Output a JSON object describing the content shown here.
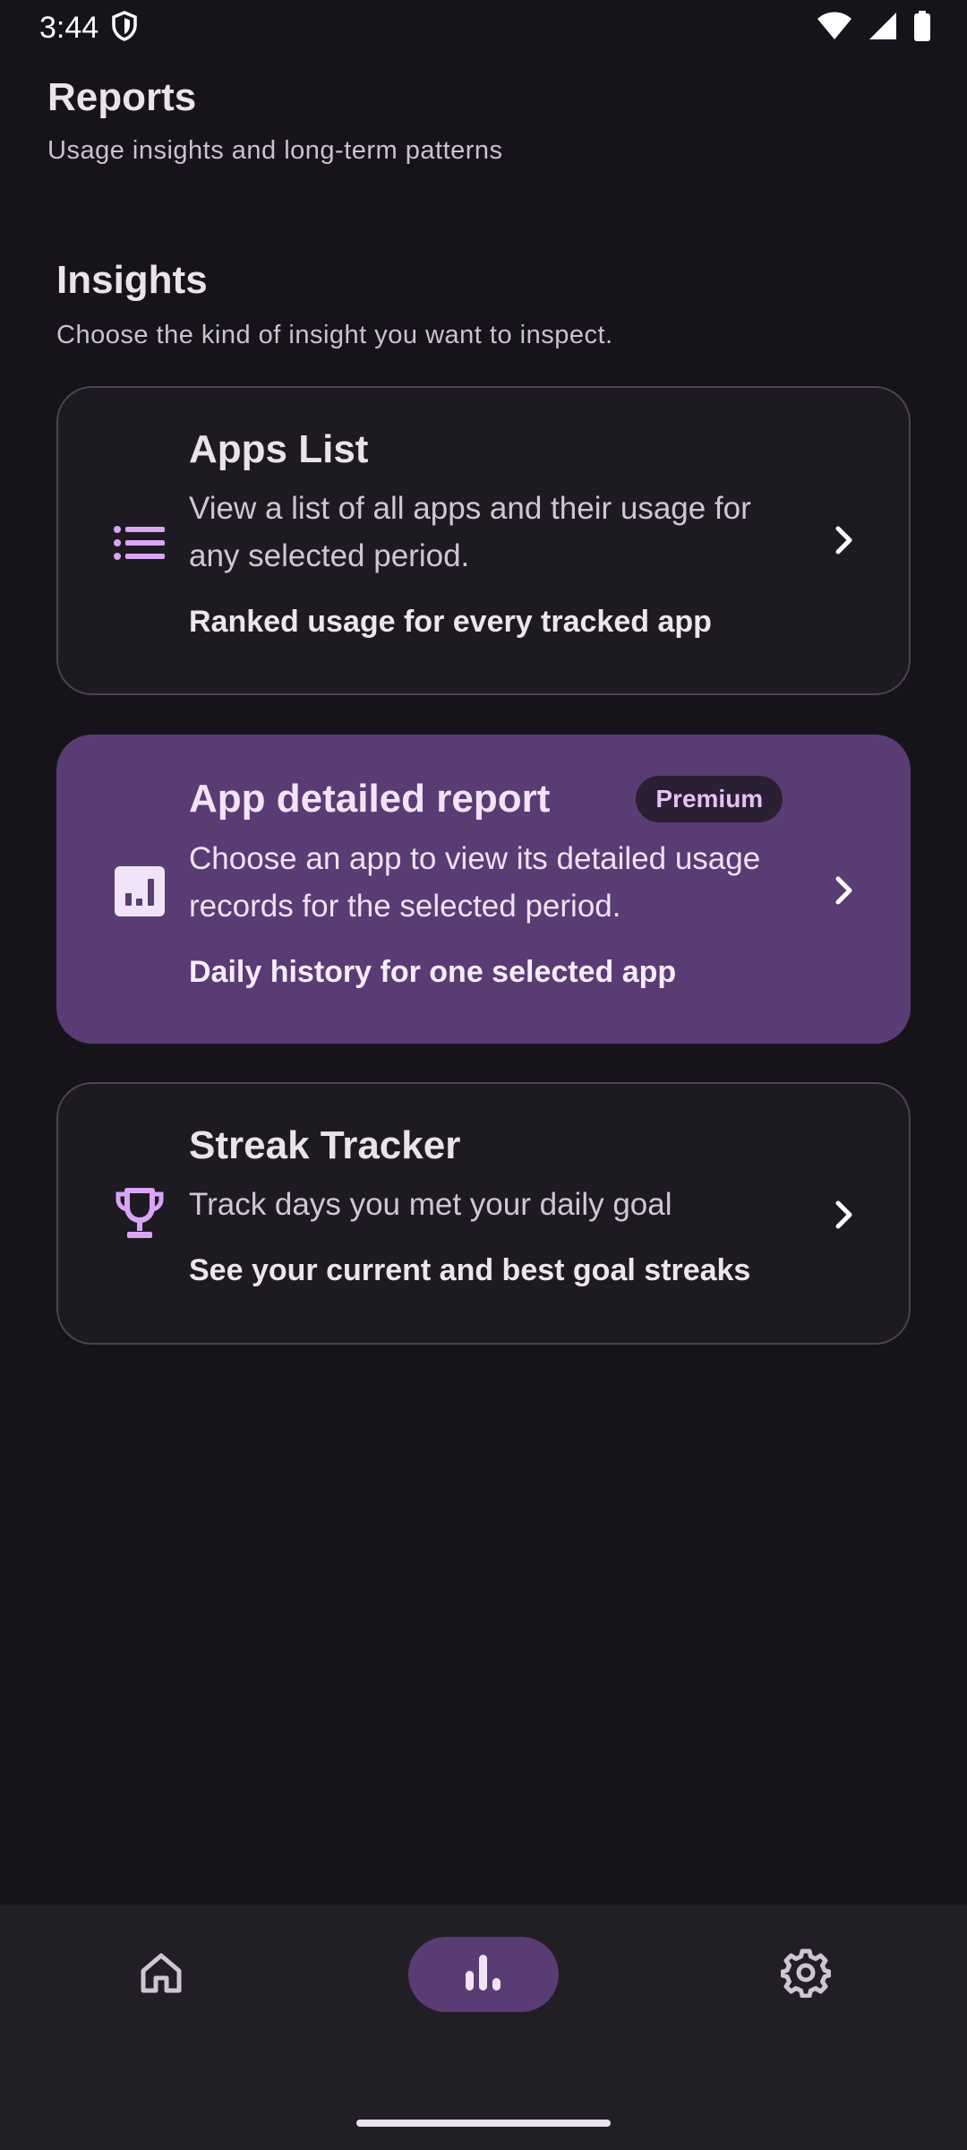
{
  "status_bar": {
    "time": "3:44",
    "icons": [
      "shield-icon",
      "wifi-icon",
      "signal-icon",
      "battery-icon"
    ]
  },
  "header": {
    "title": "Reports",
    "subtitle": "Usage insights and long-term patterns"
  },
  "insights": {
    "title": "Insights",
    "subtitle": "Choose the kind of insight you want to inspect.",
    "cards": [
      {
        "icon": "list-icon",
        "title": "Apps List",
        "description": "View a list of all apps and their usage for any selected period.",
        "note": "Ranked usage for every tracked app"
      },
      {
        "icon": "bar-chart-icon",
        "title": "App detailed report",
        "badge": "Premium",
        "description": "Choose an app to view its detailed usage records for the selected period.",
        "note": "Daily history for one selected app"
      },
      {
        "icon": "trophy-icon",
        "title": "Streak Tracker",
        "description": "Track days you met your daily goal",
        "note": "See your current and best goal streaks"
      }
    ]
  },
  "bottom_nav": {
    "items": [
      {
        "icon": "home-icon",
        "active": false
      },
      {
        "icon": "reports-icon",
        "active": true
      },
      {
        "icon": "settings-icon",
        "active": false
      }
    ]
  },
  "colors": {
    "background": "#16141a",
    "accent": "#5a3c74",
    "icon_tint": "#d9a5f5",
    "badge_text": "#e2c2f4"
  }
}
